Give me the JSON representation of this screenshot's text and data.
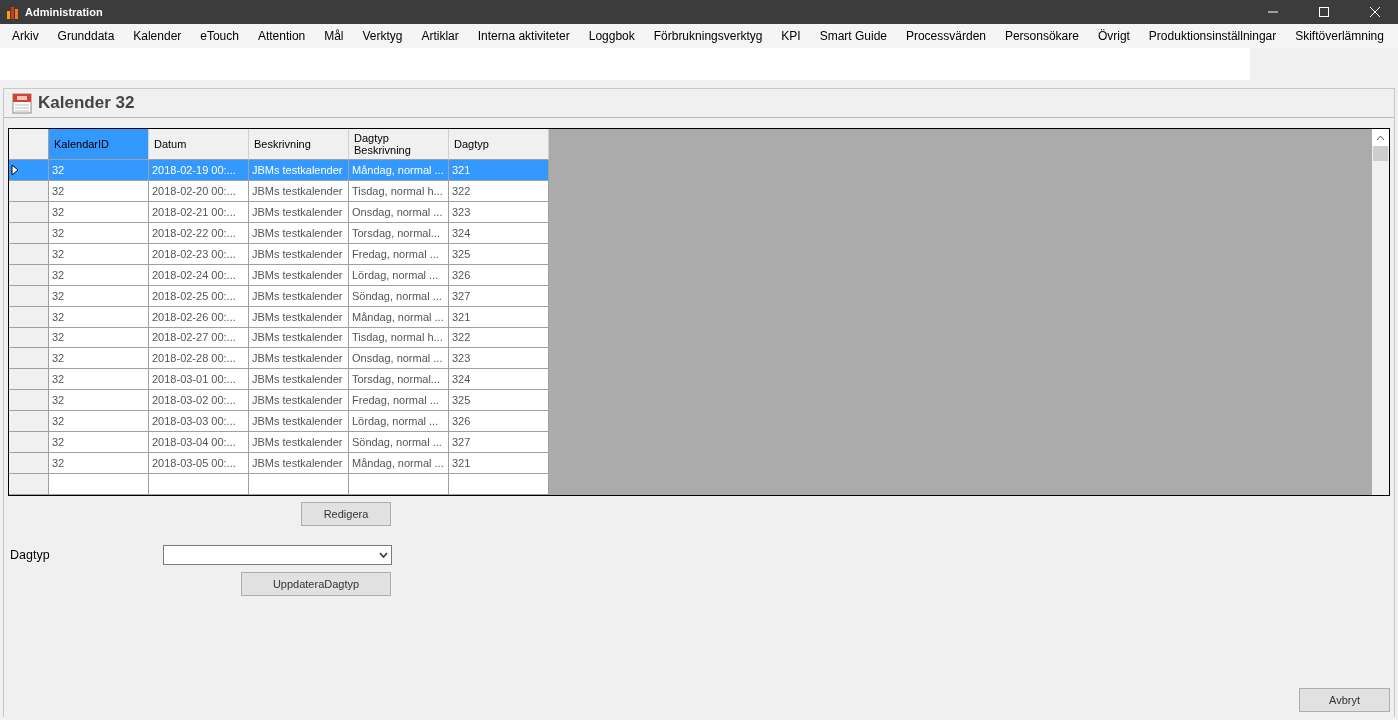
{
  "window": {
    "title": "Administration"
  },
  "menu": [
    "Arkiv",
    "Grunddata",
    "Kalender",
    "eTouch",
    "Attention",
    "Mål",
    "Verktyg",
    "Artiklar",
    "Interna aktiviteter",
    "Loggbok",
    "Förbrukningsverktyg",
    "KPI",
    "Smart Guide",
    "Processvärden",
    "Personsökare",
    "Övrigt",
    "Produktionsinställningar",
    "Skiftöverlämning"
  ],
  "page": {
    "title": "Kalender 32"
  },
  "table": {
    "columns": [
      {
        "label": "KalendarID",
        "selected": true
      },
      {
        "label": "Datum",
        "selected": false
      },
      {
        "label": "Beskrivning",
        "selected": false
      },
      {
        "label": "Dagtyp Beskrivning",
        "selected": false
      },
      {
        "label": "Dagtyp",
        "selected": false
      }
    ],
    "rows": [
      {
        "selected": true,
        "cells": [
          "32",
          "2018-02-19 00:...",
          "JBMs testkalender",
          "Måndag, normal ...",
          "321"
        ]
      },
      {
        "selected": false,
        "cells": [
          "32",
          "2018-02-20 00:...",
          "JBMs testkalender",
          "Tisdag, normal h...",
          "322"
        ]
      },
      {
        "selected": false,
        "cells": [
          "32",
          "2018-02-21 00:...",
          "JBMs testkalender",
          "Onsdag, normal ...",
          "323"
        ]
      },
      {
        "selected": false,
        "cells": [
          "32",
          "2018-02-22 00:...",
          "JBMs testkalender",
          "Torsdag, normal...",
          "324"
        ]
      },
      {
        "selected": false,
        "cells": [
          "32",
          "2018-02-23 00:...",
          "JBMs testkalender",
          "Fredag, normal ...",
          "325"
        ]
      },
      {
        "selected": false,
        "cells": [
          "32",
          "2018-02-24 00:...",
          "JBMs testkalender",
          "Lördag, normal ...",
          "326"
        ]
      },
      {
        "selected": false,
        "cells": [
          "32",
          "2018-02-25 00:...",
          "JBMs testkalender",
          "Söndag, normal ...",
          "327"
        ]
      },
      {
        "selected": false,
        "cells": [
          "32",
          "2018-02-26 00:...",
          "JBMs testkalender",
          "Måndag, normal ...",
          "321"
        ]
      },
      {
        "selected": false,
        "cells": [
          "32",
          "2018-02-27 00:...",
          "JBMs testkalender",
          "Tisdag, normal h...",
          "322"
        ]
      },
      {
        "selected": false,
        "cells": [
          "32",
          "2018-02-28 00:...",
          "JBMs testkalender",
          "Onsdag, normal ...",
          "323"
        ]
      },
      {
        "selected": false,
        "cells": [
          "32",
          "2018-03-01 00:...",
          "JBMs testkalender",
          "Torsdag, normal...",
          "324"
        ]
      },
      {
        "selected": false,
        "cells": [
          "32",
          "2018-03-02 00:...",
          "JBMs testkalender",
          "Fredag, normal ...",
          "325"
        ]
      },
      {
        "selected": false,
        "cells": [
          "32",
          "2018-03-03 00:...",
          "JBMs testkalender",
          "Lördag, normal ...",
          "326"
        ]
      },
      {
        "selected": false,
        "cells": [
          "32",
          "2018-03-04 00:...",
          "JBMs testkalender",
          "Söndag, normal ...",
          "327"
        ]
      },
      {
        "selected": false,
        "cells": [
          "32",
          "2018-03-05 00:...",
          "JBMs testkalender",
          "Måndag, normal ...",
          "321"
        ]
      }
    ]
  },
  "edit_button": "Redigera",
  "dagtyp": {
    "label": "Dagtyp"
  },
  "update_button": "UppdateraDagtyp",
  "cancel_button": "Avbryt"
}
